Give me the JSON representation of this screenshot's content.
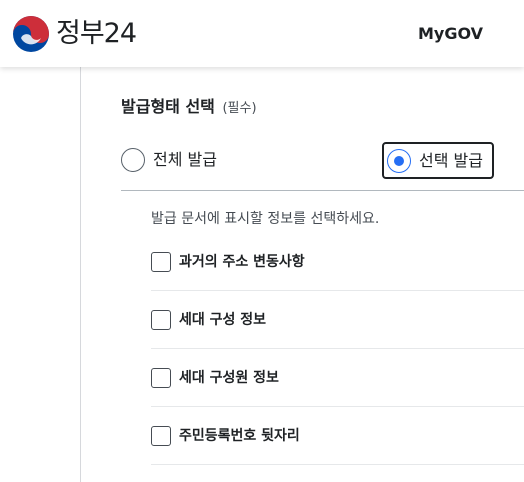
{
  "header": {
    "logo_text": "정부24",
    "logo_icon": "taegeuk-emblem-icon",
    "mygov_label": "MyGOV"
  },
  "form": {
    "title": "발급형태 선택",
    "required_label": "(필수)",
    "options": [
      {
        "label": "전체 발급",
        "checked": false
      },
      {
        "label": "선택 발급",
        "checked": true
      }
    ],
    "guide_text": "발급 문서에 표시할 정보를 선택하세요.",
    "checkboxes": [
      {
        "label": "과거의 주소 변동사항",
        "checked": false
      },
      {
        "label": "세대 구성 정보",
        "checked": false
      },
      {
        "label": "세대 구성원 정보",
        "checked": false
      },
      {
        "label": "주민등록번호 뒷자리",
        "checked": false
      }
    ]
  },
  "colors": {
    "accent": "#256ef4",
    "emblem_red": "#cd2e3a",
    "emblem_blue": "#0047a0",
    "text": "#1e2124"
  }
}
